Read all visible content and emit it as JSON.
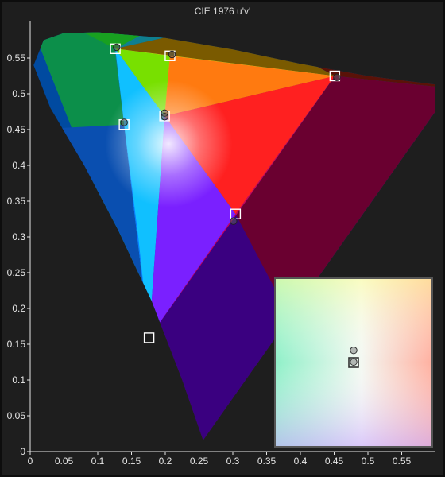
{
  "chart_data": {
    "type": "scatter",
    "title": "CIE 1976 u'v'",
    "xlabel": "",
    "ylabel": "",
    "xlim": [
      0,
      0.6
    ],
    "ylim": [
      0,
      0.6
    ],
    "x_ticks": [
      "0",
      "0.05",
      "0.1",
      "0.15",
      "0.2",
      "0.25",
      "0.3",
      "0.35",
      "0.4",
      "0.45",
      "0.5",
      "0.55"
    ],
    "y_ticks": [
      "0",
      "0.05",
      "0.1",
      "0.15",
      "0.2",
      "0.25",
      "0.3",
      "0.35",
      "0.4",
      "0.45",
      "0.5",
      "0.55"
    ],
    "grid": false,
    "spectral_locus": [
      [
        0.256,
        0.016
      ],
      [
        0.225,
        0.1
      ],
      [
        0.18,
        0.21
      ],
      [
        0.13,
        0.31
      ],
      [
        0.08,
        0.4
      ],
      [
        0.03,
        0.48
      ],
      [
        0.005,
        0.54
      ],
      [
        0.02,
        0.575
      ],
      [
        0.05,
        0.585
      ],
      [
        0.1,
        0.586
      ],
      [
        0.2,
        0.578
      ],
      [
        0.3,
        0.562
      ],
      [
        0.4,
        0.542
      ],
      [
        0.5,
        0.525
      ],
      [
        0.6,
        0.513
      ],
      [
        0.623,
        0.506
      ]
    ],
    "series": [
      {
        "name": "",
        "marker": "square",
        "points": [
          [
            0.126,
            0.563
          ],
          [
            0.207,
            0.553
          ],
          [
            0.451,
            0.525
          ],
          [
            0.199,
            0.469
          ],
          [
            0.139,
            0.457
          ],
          [
            0.304,
            0.332
          ],
          [
            0.176,
            0.159
          ]
        ]
      },
      {
        "name": "",
        "marker": "circle",
        "points": [
          [
            0.128,
            0.565
          ],
          [
            0.21,
            0.555
          ],
          [
            0.454,
            0.523
          ],
          [
            0.199,
            0.473
          ],
          [
            0.199,
            0.468
          ],
          [
            0.139,
            0.46
          ],
          [
            0.301,
            0.322
          ]
        ]
      }
    ],
    "inset": {
      "squares": [
        [
          0.5,
          0.5
        ]
      ],
      "circles": [
        [
          0.5,
          0.428
        ],
        [
          0.5,
          0.497
        ]
      ]
    },
    "colors": {
      "background": "#1e1e1e",
      "axis": "#e6e6e6"
    }
  }
}
